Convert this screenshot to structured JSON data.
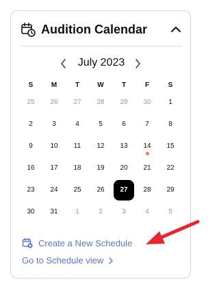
{
  "widget": {
    "title": "Audition Calendar",
    "icons": {
      "calendar": "calendar-clock-icon",
      "collapse": "chevron-up-icon"
    }
  },
  "calendar": {
    "month_label": "July 2023",
    "weekdays": [
      "S",
      "M",
      "T",
      "W",
      "T",
      "F",
      "S"
    ],
    "weeks": [
      [
        "25",
        "26",
        "27",
        "28",
        "29",
        "30",
        "1"
      ],
      [
        "2",
        "3",
        "4",
        "5",
        "6",
        "7",
        "8"
      ],
      [
        "9",
        "10",
        "11",
        "12",
        "13",
        "14",
        "15"
      ],
      [
        "16",
        "17",
        "18",
        "19",
        "20",
        "21",
        "22"
      ],
      [
        "23",
        "24",
        "25",
        "26",
        "27",
        "28",
        "29"
      ],
      [
        "30",
        "31",
        "1",
        "2",
        "3",
        "4",
        "5"
      ]
    ],
    "selected_day": "27",
    "event_day": "14",
    "colors": {
      "selected_bg": "#000000",
      "event_dot": "#f07a5a",
      "link": "#5b76d6",
      "annotation_arrow": "#e8262b"
    }
  },
  "actions": {
    "create_schedule": "Create a New Schedule",
    "go_to_schedule": "Go to Schedule view"
  }
}
